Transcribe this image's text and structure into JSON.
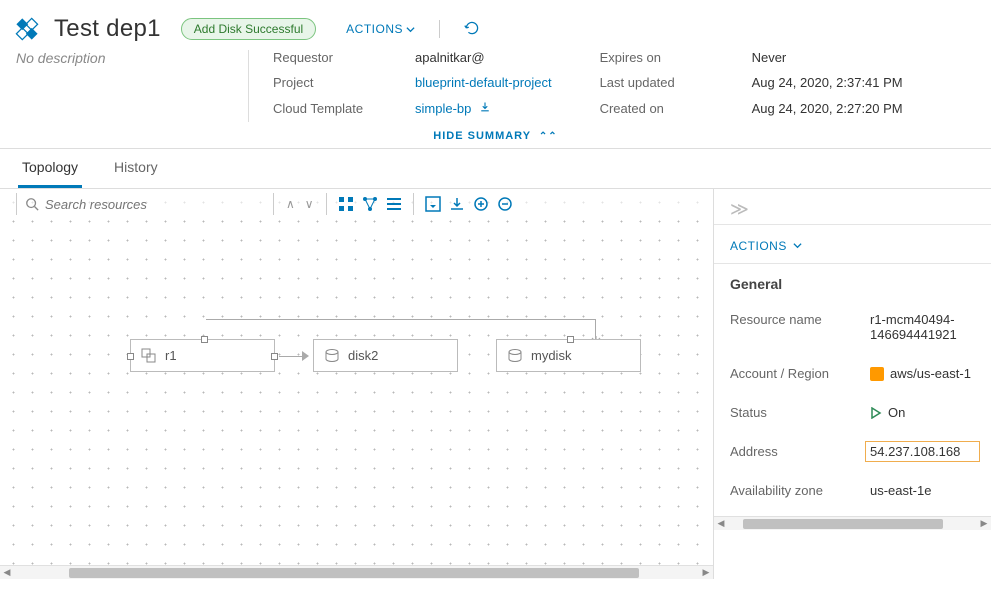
{
  "header": {
    "title": "Test dep1",
    "badge": "Add Disk Successful",
    "actions_label": "ACTIONS",
    "description": "No description"
  },
  "summary": {
    "requestor_label": "Requestor",
    "requestor_value": "apalnitkar@",
    "project_label": "Project",
    "project_value": "blueprint-default-project",
    "template_label": "Cloud Template",
    "template_value": "simple-bp",
    "expires_label": "Expires on",
    "expires_value": "Never",
    "updated_label": "Last updated",
    "updated_value": "Aug 24, 2020, 2:37:41 PM",
    "created_label": "Created on",
    "created_value": "Aug 24, 2020, 2:27:20 PM",
    "hide_label": "HIDE SUMMARY"
  },
  "tabs": {
    "topology": "Topology",
    "history": "History"
  },
  "toolbar": {
    "search_placeholder": "Search resources"
  },
  "nodes": {
    "r1": "r1",
    "disk2": "disk2",
    "mydisk": "mydisk"
  },
  "side": {
    "actions": "ACTIONS",
    "section": "General",
    "name_label": "Resource name",
    "name_value": "r1-mcm40494-146694441921",
    "account_label": "Account / Region",
    "account_value": "aws/us-east-1",
    "status_label": "Status",
    "status_value": "On",
    "address_label": "Address",
    "address_value": "54.237.108.168",
    "az_label": "Availability zone",
    "az_value": "us-east-1e"
  }
}
